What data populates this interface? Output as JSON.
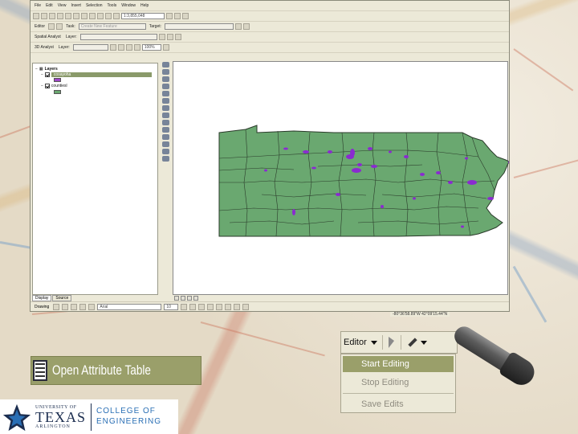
{
  "app": {
    "menus": [
      "File",
      "Edit",
      "View",
      "Insert",
      "Selection",
      "Tools",
      "Window",
      "Help"
    ],
    "scale": "1:3,855,048"
  },
  "toolbars": {
    "editor_label": "Editor",
    "task_label": "Task:",
    "task_value": "Create New Feature",
    "target_label": "Target:",
    "spatial_analyst_label": "Spatial Analyst",
    "layer_label": "Layer:",
    "analyst3d_label": "3D Analyst",
    "zoom_pct": "100%"
  },
  "toc": {
    "root": "Layers",
    "layers": [
      {
        "name": "cosayoha",
        "swatch": "#a046c8",
        "selected": true
      },
      {
        "name": "countiesl",
        "swatch": "#6aa870",
        "selected": false
      }
    ],
    "tabs": [
      "Display",
      "Source"
    ]
  },
  "statusbar": {
    "drawing_label": "Drawing",
    "font": "Arial",
    "font_size": "10"
  },
  "coordinates": "-80°36'58.89\"W  42°09'15.44\"N",
  "callout": {
    "open_attribute_table": "Open Attribute Table"
  },
  "editor_menu": {
    "title": "Editor",
    "items": [
      {
        "label": "Start Editing",
        "highlighted": true
      },
      {
        "label": "Stop Editing",
        "highlighted": false
      },
      {
        "label": "Save Edits",
        "highlighted": false
      }
    ]
  },
  "logo": {
    "line1": "UNIVERSITY OF",
    "line2": "TEXAS",
    "line3": "ARLINGTON",
    "college1": "COLLEGE OF",
    "college2": "ENGINEERING"
  },
  "colors": {
    "map_fill": "#6aa870",
    "polygon_highlight": "#8a2bd0",
    "menu_highlight": "#9a9f6a"
  }
}
